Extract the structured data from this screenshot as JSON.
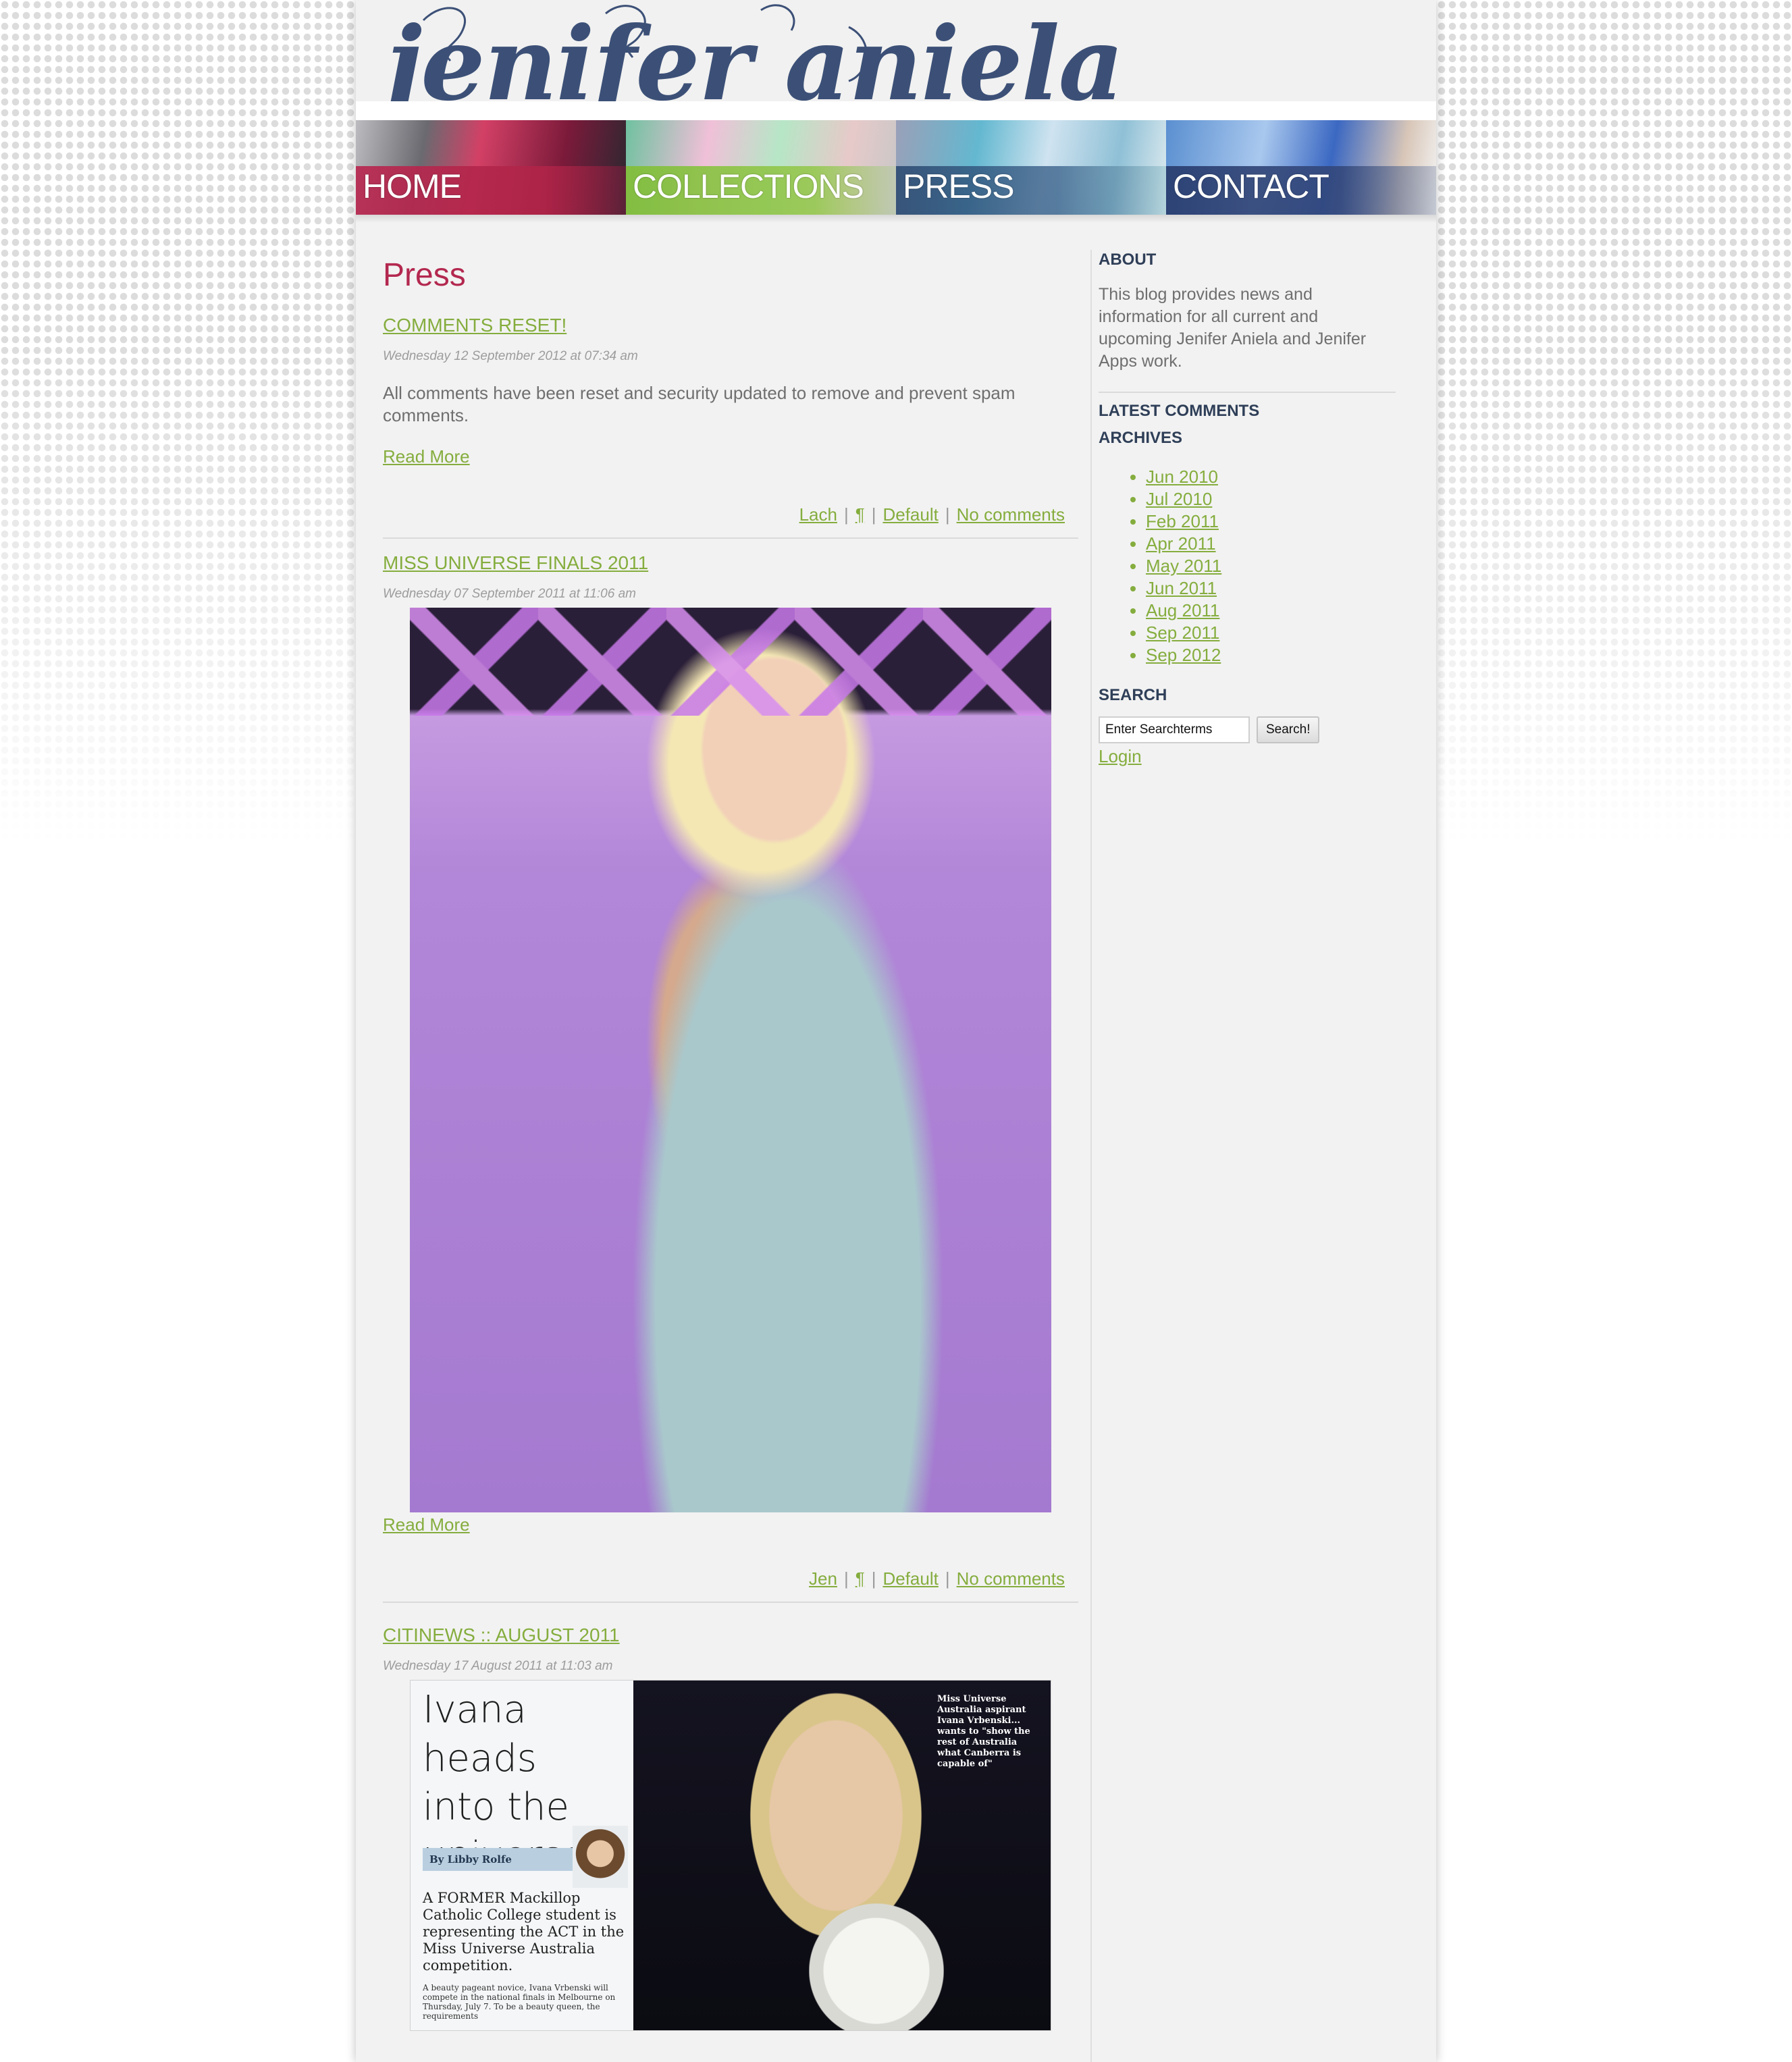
{
  "site": {
    "logo_text": "jenifer aniela"
  },
  "nav": {
    "items": [
      {
        "label": "HOME"
      },
      {
        "label": "COLLECTIONS"
      },
      {
        "label": "PRESS"
      },
      {
        "label": "CONTACT"
      }
    ]
  },
  "main": {
    "page_title": "Press",
    "posts": [
      {
        "title": "COMMENTS RESET!",
        "date": "Wednesday 12 September 2012 at 07:34 am",
        "body": "All comments have been reset and security updated to remove and prevent spam comments.",
        "read_more": "Read More",
        "author": "Lach",
        "pilcrow": "¶",
        "category": "Default",
        "comments": "No comments"
      },
      {
        "title": "MISS UNIVERSE FINALS 2011",
        "date": "Wednesday 07 September 2011 at 11:06 am",
        "read_more": "Read More",
        "author": "Jen",
        "pilcrow": "¶",
        "category": "Default",
        "comments": "No comments"
      },
      {
        "title": "CITINEWS :: AUGUST 2011",
        "date": "Wednesday 17 August 2011 at 11:03 am",
        "clipping": {
          "headline_line1": "Ivana heads",
          "headline_line2": "into the",
          "headline_line3": "universe",
          "byline": "By Libby Rolfe",
          "lead": "A FORMER Mackillop Catholic College student is representing the ACT in the Miss Universe Australia competition.",
          "small": "A beauty pageant novice, Ivana Vrbenski will compete in the national finals in Melbourne on Thursday, July 7. To be a beauty queen, the requirements",
          "caption": "Miss Universe Australia aspirant Ivana Vrbenski... wants to \"show the rest of Australia what Canberra is capable of\""
        }
      }
    ]
  },
  "sidebar": {
    "about_heading": "ABOUT",
    "about_text": "This blog provides news and information for all current and upcoming Jenifer Aniela and Jenifer Apps work.",
    "latest_comments_heading": "LATEST COMMENTS",
    "archives_heading": "ARCHIVES",
    "archives": [
      "Jun 2010",
      "Jul 2010",
      "Feb 2011",
      "Apr 2011",
      "May 2011",
      "Jun 2011",
      "Aug 2011",
      "Sep 2011",
      "Sep 2012"
    ],
    "search_heading": "SEARCH",
    "search_value": "Enter Searchterms",
    "search_button": "Search!",
    "login": "Login"
  },
  "colors": {
    "link_green": "#85ad3e",
    "title_red": "#b3284f",
    "heading_navy": "#2f3f58"
  }
}
